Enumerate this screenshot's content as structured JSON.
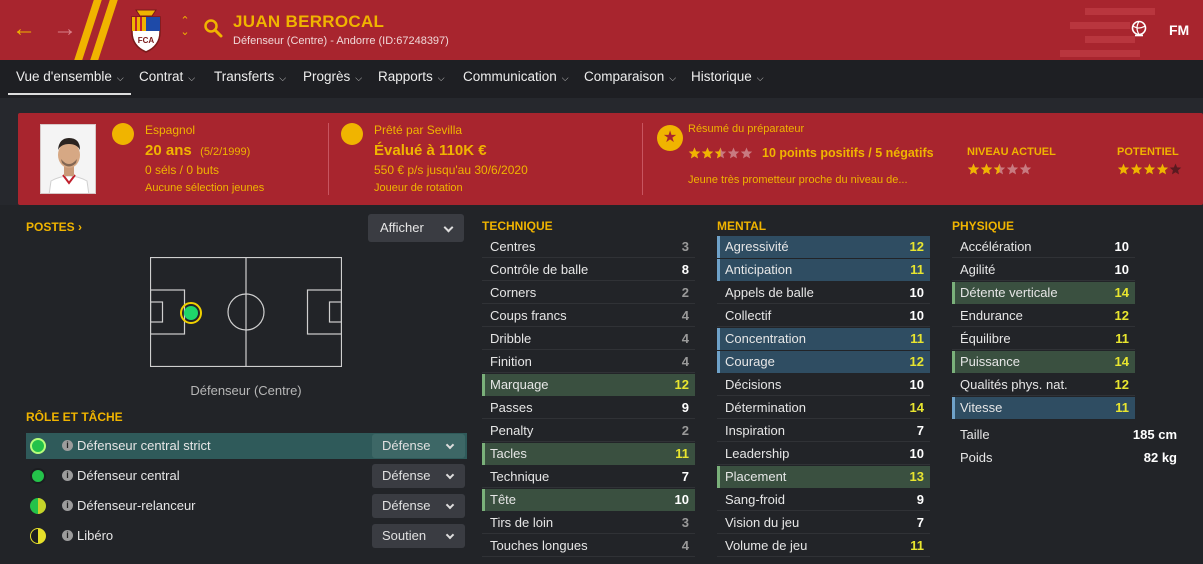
{
  "header": {
    "player_name": "JUAN BERROCAL",
    "subtitle": "Défenseur (Centre) - Andorre (ID:67248397)",
    "crest_text": "FCA",
    "fm_label": "FM"
  },
  "tabs": [
    {
      "label": "Vue d'ensemble"
    },
    {
      "label": "Contrat"
    },
    {
      "label": "Transferts"
    },
    {
      "label": "Progrès"
    },
    {
      "label": "Rapports"
    },
    {
      "label": "Communication"
    },
    {
      "label": "Comparaison"
    },
    {
      "label": "Historique"
    }
  ],
  "info": {
    "nationality": "Espagnol",
    "age": "20 ans",
    "dob": "(5/2/1999)",
    "caps": "0 séls / 0 buts",
    "youth_caps": "Aucune sélection jeunes",
    "loan_from": "Prêté par Sevilla",
    "value": "Évalué à 110K €",
    "wage": "550 € p/s jusqu'au 30/6/2020",
    "squad_status": "Joueur de rotation",
    "coach_title": "Résumé du préparateur",
    "coach_summary": "10 points positifs / 5 négatifs",
    "coach_note": "Jeune très prometteur proche du niveau de...",
    "current_ability_label": "NIVEAU ACTUEL",
    "potential_label": "POTENTIEL",
    "coach_stars": 2.5,
    "current_ability_stars": 2.5,
    "potential_stars": 4
  },
  "positions": {
    "title": "POSTES",
    "show_button": "Afficher",
    "position_label": "Défenseur (Centre)"
  },
  "roles": {
    "title": "RÔLE ET TÂCHE",
    "items": [
      {
        "name": "Défenseur central strict",
        "duty": "Défense"
      },
      {
        "name": "Défenseur central",
        "duty": "Défense"
      },
      {
        "name": "Défenseur-relanceur",
        "duty": "Défense"
      },
      {
        "name": "Libéro",
        "duty": "Soutien"
      }
    ]
  },
  "technique": {
    "title": "TECHNIQUE",
    "items": [
      {
        "name": "Centres",
        "value": "3"
      },
      {
        "name": "Contrôle de balle",
        "value": "8"
      },
      {
        "name": "Corners",
        "value": "2"
      },
      {
        "name": "Coups francs",
        "value": "4"
      },
      {
        "name": "Dribble",
        "value": "4"
      },
      {
        "name": "Finition",
        "value": "4"
      },
      {
        "name": "Marquage",
        "value": "12"
      },
      {
        "name": "Passes",
        "value": "9"
      },
      {
        "name": "Penalty",
        "value": "2"
      },
      {
        "name": "Tacles",
        "value": "11"
      },
      {
        "name": "Technique",
        "value": "7"
      },
      {
        "name": "Tête",
        "value": "10"
      },
      {
        "name": "Tirs de loin",
        "value": "3"
      },
      {
        "name": "Touches longues",
        "value": "4"
      }
    ]
  },
  "mental": {
    "title": "MENTAL",
    "items": [
      {
        "name": "Agressivité",
        "value": "12"
      },
      {
        "name": "Anticipation",
        "value": "11"
      },
      {
        "name": "Appels de balle",
        "value": "10"
      },
      {
        "name": "Collectif",
        "value": "10"
      },
      {
        "name": "Concentration",
        "value": "11"
      },
      {
        "name": "Courage",
        "value": "12"
      },
      {
        "name": "Décisions",
        "value": "10"
      },
      {
        "name": "Détermination",
        "value": "14"
      },
      {
        "name": "Inspiration",
        "value": "7"
      },
      {
        "name": "Leadership",
        "value": "10"
      },
      {
        "name": "Placement",
        "value": "13"
      },
      {
        "name": "Sang-froid",
        "value": "9"
      },
      {
        "name": "Vision du jeu",
        "value": "7"
      },
      {
        "name": "Volume de jeu",
        "value": "11"
      }
    ]
  },
  "physique": {
    "title": "PHYSIQUE",
    "items": [
      {
        "name": "Accélération",
        "value": "10"
      },
      {
        "name": "Agilité",
        "value": "10"
      },
      {
        "name": "Détente verticale",
        "value": "14"
      },
      {
        "name": "Endurance",
        "value": "12"
      },
      {
        "name": "Équilibre",
        "value": "11"
      },
      {
        "name": "Puissance",
        "value": "14"
      },
      {
        "name": "Qualités phys. nat.",
        "value": "12"
      },
      {
        "name": "Vitesse",
        "value": "11"
      }
    ],
    "height_label": "Taille",
    "height": "185 cm",
    "weight_label": "Poids",
    "weight": "82 kg"
  },
  "colors": {
    "header_red": "#a8252e",
    "accent_yellow": "#f0b400",
    "value_high": "#e8e52f",
    "highlight_blue": "#2f4d62",
    "highlight_green": "#3a5040"
  }
}
